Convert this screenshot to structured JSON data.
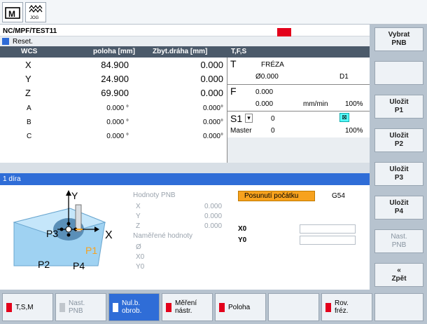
{
  "header": {
    "program_path": "NC/MPF/TEST11",
    "status": "Reset.",
    "mode_label": "JOG"
  },
  "axes_table": {
    "col_wcs": "WCS",
    "col_position": "poloha [mm]",
    "col_distance": "Zbyt.dráha [mm]",
    "col_tfs": "T,F,S",
    "rows": [
      {
        "axis": "X",
        "pos": "84.900",
        "dist": "0.000"
      },
      {
        "axis": "Y",
        "pos": "24.900",
        "dist": "0.000"
      },
      {
        "axis": "Z",
        "pos": "69.900",
        "dist": "0.000"
      },
      {
        "axis": "A",
        "pos": "0.000 °",
        "dist": "0.000°"
      },
      {
        "axis": "B",
        "pos": "0.000 °",
        "dist": "0.000°"
      },
      {
        "axis": "C",
        "pos": "0.000 °",
        "dist": "0.000°"
      }
    ]
  },
  "tfs": {
    "t_label": "T",
    "tool_name": "FRÉZA",
    "tool_dia": "Ø0.000",
    "tool_d": "D1",
    "f_label": "F",
    "f_value1": "0.000",
    "f_value2": "0.000",
    "f_unit": "mm/min",
    "f_pct": "100%",
    "s_label": "S1",
    "s_value": "0",
    "s_master": "Master",
    "s_master_value": "0",
    "s_pct": "100%"
  },
  "measure": {
    "title": "1 díra",
    "nodes_label": "Hodnoty PNB",
    "x_label": "X",
    "x_val": "0.000",
    "y_label": "Y",
    "y_val": "0.000",
    "z_label": "Z",
    "z_val": "0.000",
    "measured_label": "Naměřené hodnoty",
    "dia_label": "Ø",
    "x0_label": "X0",
    "y0_label": "Y0",
    "offset_button": "Posunutí počátku",
    "offset_value": "G54",
    "field_x0_label": "X0",
    "field_y0_label": "Y0",
    "pic_p1": "P1",
    "pic_p2": "P2",
    "pic_p3": "P3",
    "pic_p4": "P4",
    "pic_x": "X",
    "pic_y": "Y"
  },
  "softkeys_right": [
    {
      "label": "Vybrat\nPNB",
      "enabled": true
    },
    {
      "label": "",
      "enabled": true
    },
    {
      "label": "Uložit\nP1",
      "enabled": true
    },
    {
      "label": "Uložit\nP2",
      "enabled": true
    },
    {
      "label": "Uložit\nP3",
      "enabled": true
    },
    {
      "label": "Uložit\nP4",
      "enabled": true
    },
    {
      "label": "Nast.\nPNB",
      "enabled": false
    },
    {
      "label": "«\nZpět",
      "enabled": true
    }
  ],
  "softkeys_bottom": [
    {
      "label": "T,S,M"
    },
    {
      "label": "Nast.\nPNB"
    },
    {
      "label": "Nul.b.\nobrob."
    },
    {
      "label": "Měření\nnástr."
    },
    {
      "label": "Poloha"
    },
    {
      "label": ""
    },
    {
      "label": "Rov.\nfréz."
    },
    {
      "label": ""
    }
  ],
  "scroll_label": ">",
  "colors": {
    "accent": "#2f6dd7",
    "header": "#4b5a6a",
    "orange": "#f7a21e",
    "alarm": "#e3001b"
  }
}
